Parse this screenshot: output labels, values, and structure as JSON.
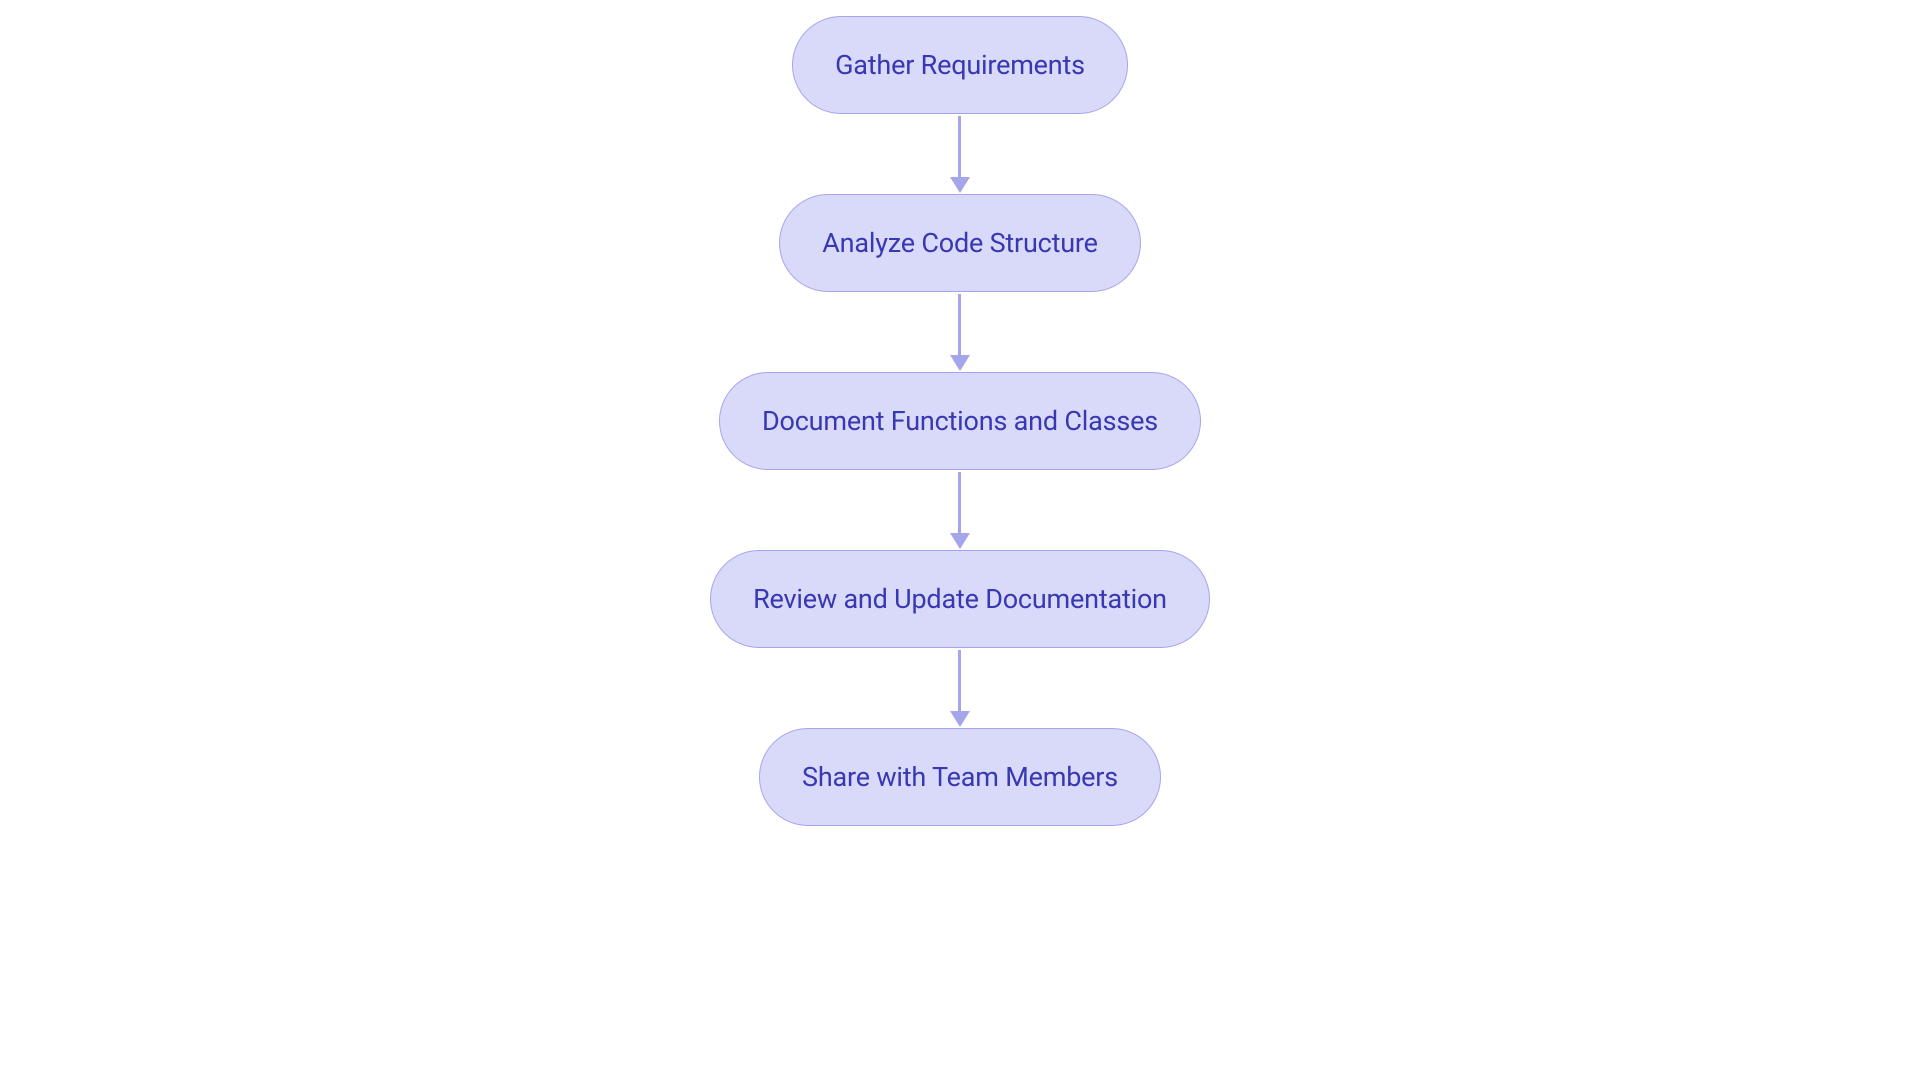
{
  "flowchart": {
    "nodes": [
      {
        "label": "Gather Requirements"
      },
      {
        "label": "Analyze Code Structure"
      },
      {
        "label": "Document Functions and Classes"
      },
      {
        "label": "Review and Update Documentation"
      },
      {
        "label": "Share with Team Members"
      }
    ]
  }
}
